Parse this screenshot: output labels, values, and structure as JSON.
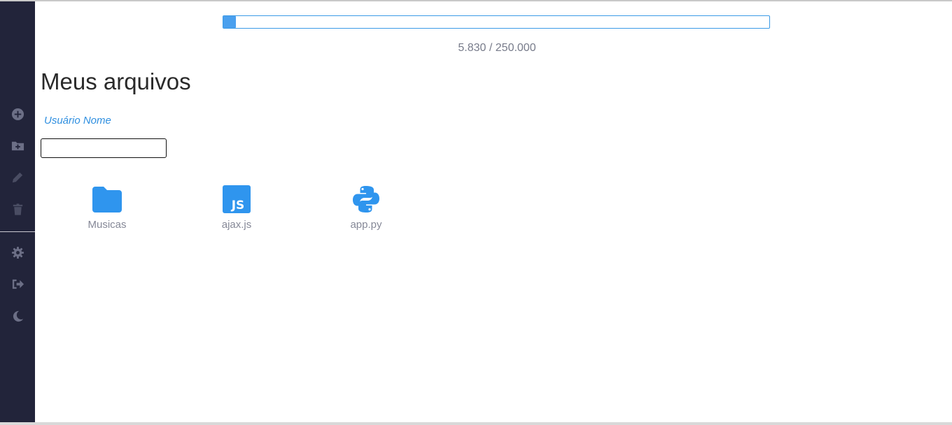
{
  "colors": {
    "sidebar_bg": "#22243a",
    "accent": "#2f8fe0",
    "progress_fill": "#4aa0ee"
  },
  "sidebar": {
    "top_items": [
      {
        "icon": "plus-circle-icon",
        "label": "new file"
      },
      {
        "icon": "folder-plus-icon",
        "label": "new folder"
      },
      {
        "icon": "pencil-icon",
        "label": "rename"
      },
      {
        "icon": "trash-icon",
        "label": "delete"
      }
    ],
    "bottom_items": [
      {
        "icon": "gear-icon",
        "label": "settings"
      },
      {
        "icon": "sign-out-icon",
        "label": "logout"
      },
      {
        "icon": "moon-icon",
        "label": "dark mode"
      }
    ]
  },
  "storage": {
    "usage_text": "5.830 / 250.000",
    "used_fraction": 0.0233
  },
  "page_title": "Meus arquivos",
  "user": {
    "name": "Usuário Nome"
  },
  "search": {
    "value": "",
    "placeholder": ""
  },
  "files": [
    {
      "name": "Musicas",
      "icon": "folder-icon"
    },
    {
      "name": "ajax.js",
      "icon": "javascript-file-icon"
    },
    {
      "name": "app.py",
      "icon": "python-file-icon"
    }
  ]
}
